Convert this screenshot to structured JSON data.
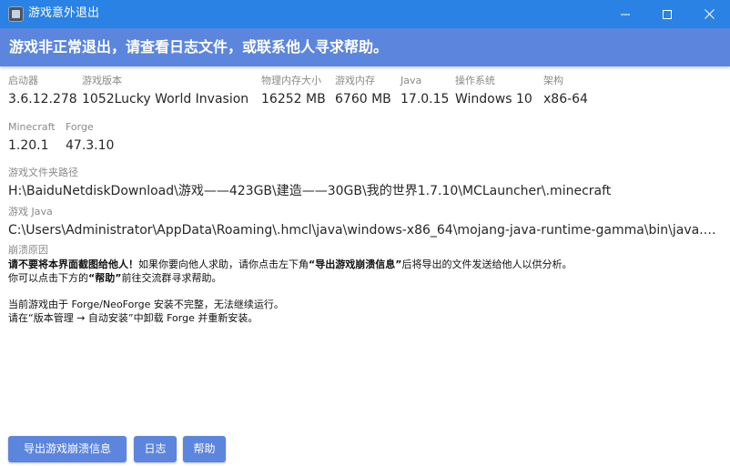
{
  "window": {
    "title": "游戏意外退出",
    "icon": "launcher-app-icon",
    "controls": {
      "minimize_icon": "minimize-icon",
      "maximize_icon": "maximize-icon",
      "close_icon": "close-icon"
    }
  },
  "banner": {
    "text": "游戏非正常退出，请查看日志文件，或联系他人寻求帮助。",
    "color": "#5c85dd"
  },
  "info": {
    "launcher": {
      "label": "启动器",
      "value": "3.6.12.278"
    },
    "game_version": {
      "label": "游戏版本",
      "value": "1052Lucky World Invasion"
    },
    "physical_memory": {
      "label": "物理内存大小",
      "value": "16252 MB"
    },
    "game_memory": {
      "label": "游戏内存",
      "value": "6760 MB"
    },
    "java": {
      "label": "Java",
      "value": "17.0.15"
    },
    "os": {
      "label": "操作系统",
      "value": "Windows 10"
    },
    "arch": {
      "label": "架构",
      "value": "x86-64"
    },
    "minecraft": {
      "label": "Minecraft",
      "value": "1.20.1"
    },
    "forge": {
      "label": "Forge",
      "value": "47.3.10"
    },
    "game_dir": {
      "label": "游戏文件夹路径",
      "value": "H:\\BaiduNetdiskDownload\\游戏——423GB\\建造——30GB\\我的世界1.7.10\\MCLauncher\\.minecraft"
    },
    "game_java": {
      "label": "游戏 Java",
      "value": "C:\\Users\\Administrator\\AppData\\Roaming\\.hmcl\\java\\windows-x86_64\\mojang-java-runtime-gamma\\bin\\java.exe"
    }
  },
  "crash_reason": {
    "label": "崩溃原因",
    "line1_bold": "请不要将本界面截图给他人！",
    "line1_mid": "如果你要向他人求助，请你点击左下角",
    "line1_bold2": "“导出游戏崩溃信息”",
    "line1_tail": "后将导出的文件发送给他人以供分析。",
    "line2_head": "你可以点击下方的",
    "line2_bold": "“帮助”",
    "line2_tail": "前往交流群寻求帮助。",
    "line3": "当前游戏由于 Forge/NeoForge 安装不完整，无法继续运行。",
    "line4": "请在“版本管理 → 自动安装”中卸载 Forge 并重新安装。"
  },
  "buttons": {
    "export": "导出游戏崩溃信息",
    "log": "日志",
    "help": "帮助"
  },
  "colors": {
    "titlebar": "#2a82e4",
    "accent": "#5c85dd"
  }
}
